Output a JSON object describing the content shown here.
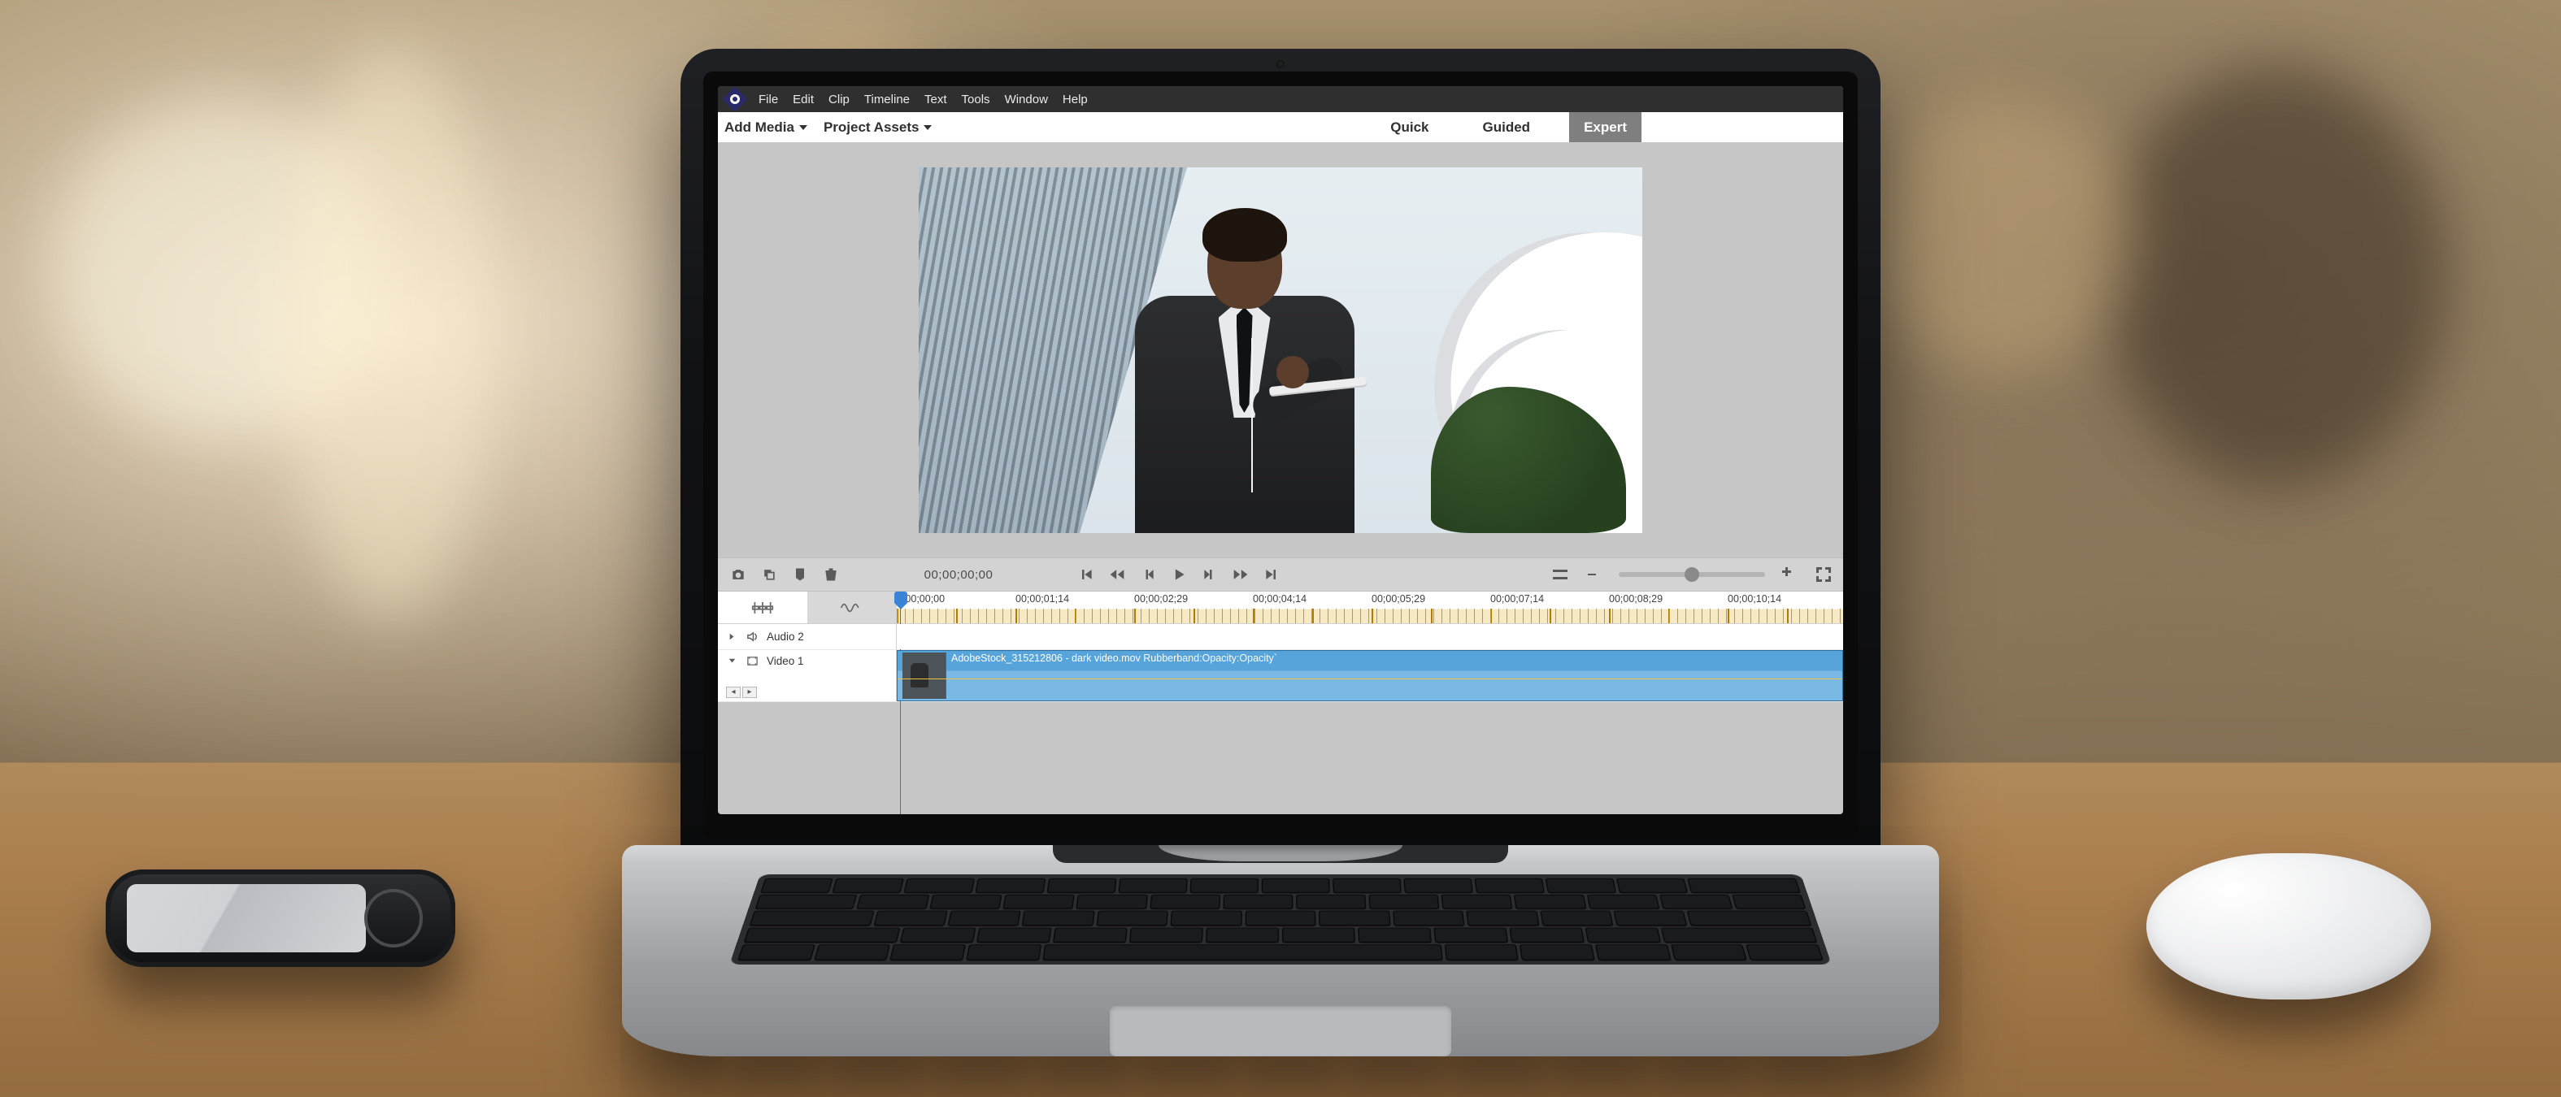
{
  "menu": {
    "items": [
      "File",
      "Edit",
      "Clip",
      "Timeline",
      "Text",
      "Tools",
      "Window",
      "Help"
    ]
  },
  "toolbar": {
    "add_media": "Add Media",
    "project_assets": "Project Assets"
  },
  "mode_tabs": {
    "quick": "Quick",
    "guided": "Guided",
    "expert": "Expert",
    "active": "Expert"
  },
  "transport": {
    "timecode": "00;00;00;00"
  },
  "ruler": {
    "labels": [
      "0;00;00;00",
      "00;00;01;14",
      "00;00;02;29",
      "00;00;04;14",
      "00;00;05;29",
      "00;00;07;14",
      "00;00;08;29",
      "00;00;10;14"
    ]
  },
  "tracks": {
    "audio2": {
      "label": "Audio 2"
    },
    "video1": {
      "label": "Video 1",
      "clip_filename": "AdobeStock_315212806 - dark video.mov",
      "clip_prop": "Rubberband:Opacity:Opacity`"
    }
  }
}
